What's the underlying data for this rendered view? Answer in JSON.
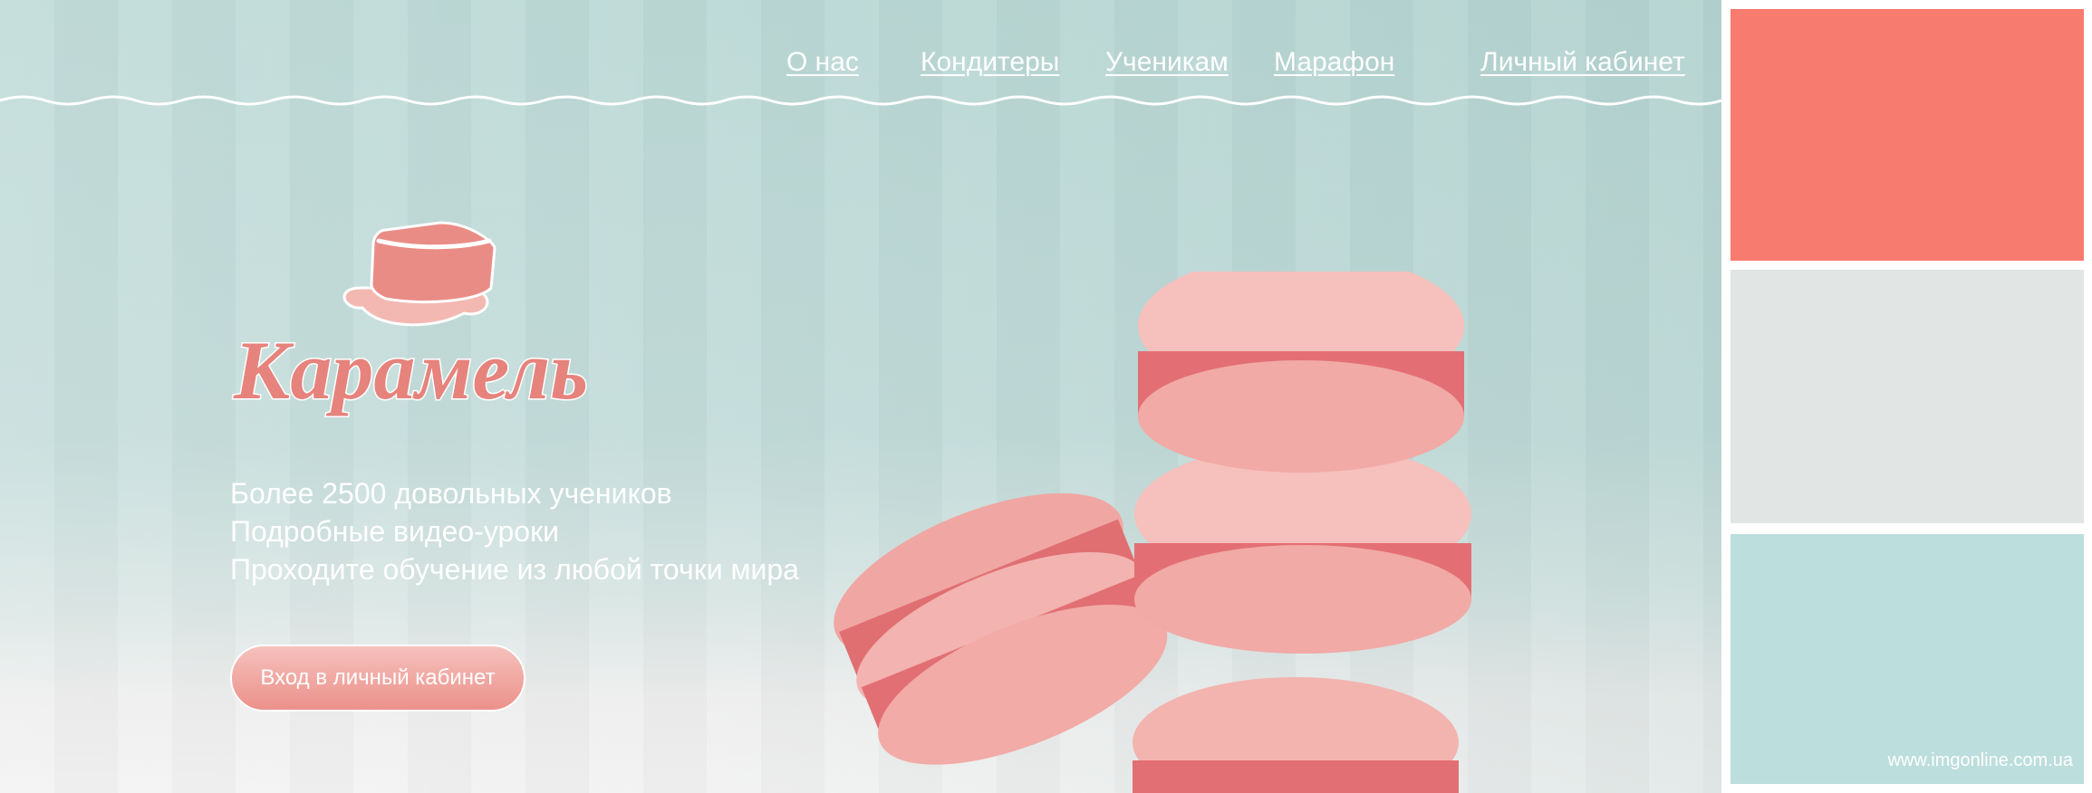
{
  "nav": {
    "about": "О нас",
    "confectioners": "Кондитеры",
    "students": "Ученикам",
    "marathon": "Марафон",
    "account": "Личный кабинет"
  },
  "logo": {
    "text": "Карамель"
  },
  "features": [
    "Более 2500 довольных учеников",
    "Подробные видео-уроки",
    "Проходите обучение из любой точки мира"
  ],
  "cta": {
    "label": "Вход в личный кабинет"
  },
  "palette": {
    "swatches": [
      "#f87b6f",
      "#e1e5e3",
      "#bcdedd"
    ]
  },
  "watermark": "www.imgonline.com.ua"
}
